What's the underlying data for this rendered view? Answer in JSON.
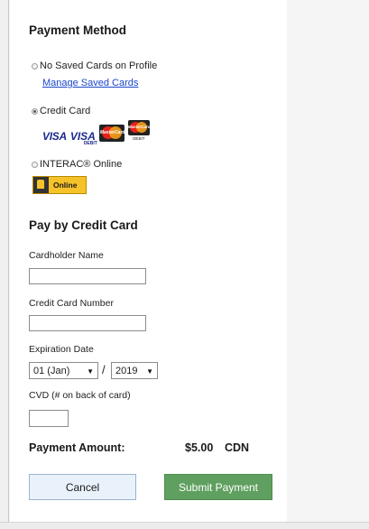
{
  "payment_method": {
    "title": "Payment Method",
    "options": [
      {
        "label": "No Saved Cards on Profile",
        "checked": false,
        "link": "Manage Saved Cards"
      },
      {
        "label": "Credit Card",
        "checked": true
      },
      {
        "label": "INTERAC® Online",
        "checked": false
      }
    ],
    "card_logos": {
      "visa": "VISA",
      "visa_debit": "VISA",
      "visa_debit_sub": "DEBIT",
      "mastercard": "MasterCard",
      "mastercard_debit": "MasterCard",
      "mastercard_debit_sub": "DEBIT"
    },
    "interac_logo_text": "Online"
  },
  "pay_by_card": {
    "title": "Pay by Credit Card",
    "cardholder_label": "Cardholder Name",
    "cardholder_value": "",
    "card_number_label": "Credit Card Number",
    "card_number_value": "",
    "expiration_label": "Expiration Date",
    "exp_month": "01 (Jan)",
    "exp_separator": "/",
    "exp_year": "2019",
    "cvd_label": "CVD (# on back of card)",
    "cvd_value": ""
  },
  "payment_amount": {
    "label": "Payment Amount:",
    "value": "$5.00",
    "currency": "CDN"
  },
  "buttons": {
    "cancel": "Cancel",
    "submit": "Submit Payment"
  },
  "colors": {
    "link": "#1a47c9",
    "submit_bg": "#5f9f5f",
    "cancel_bg": "#e9f2fb"
  }
}
